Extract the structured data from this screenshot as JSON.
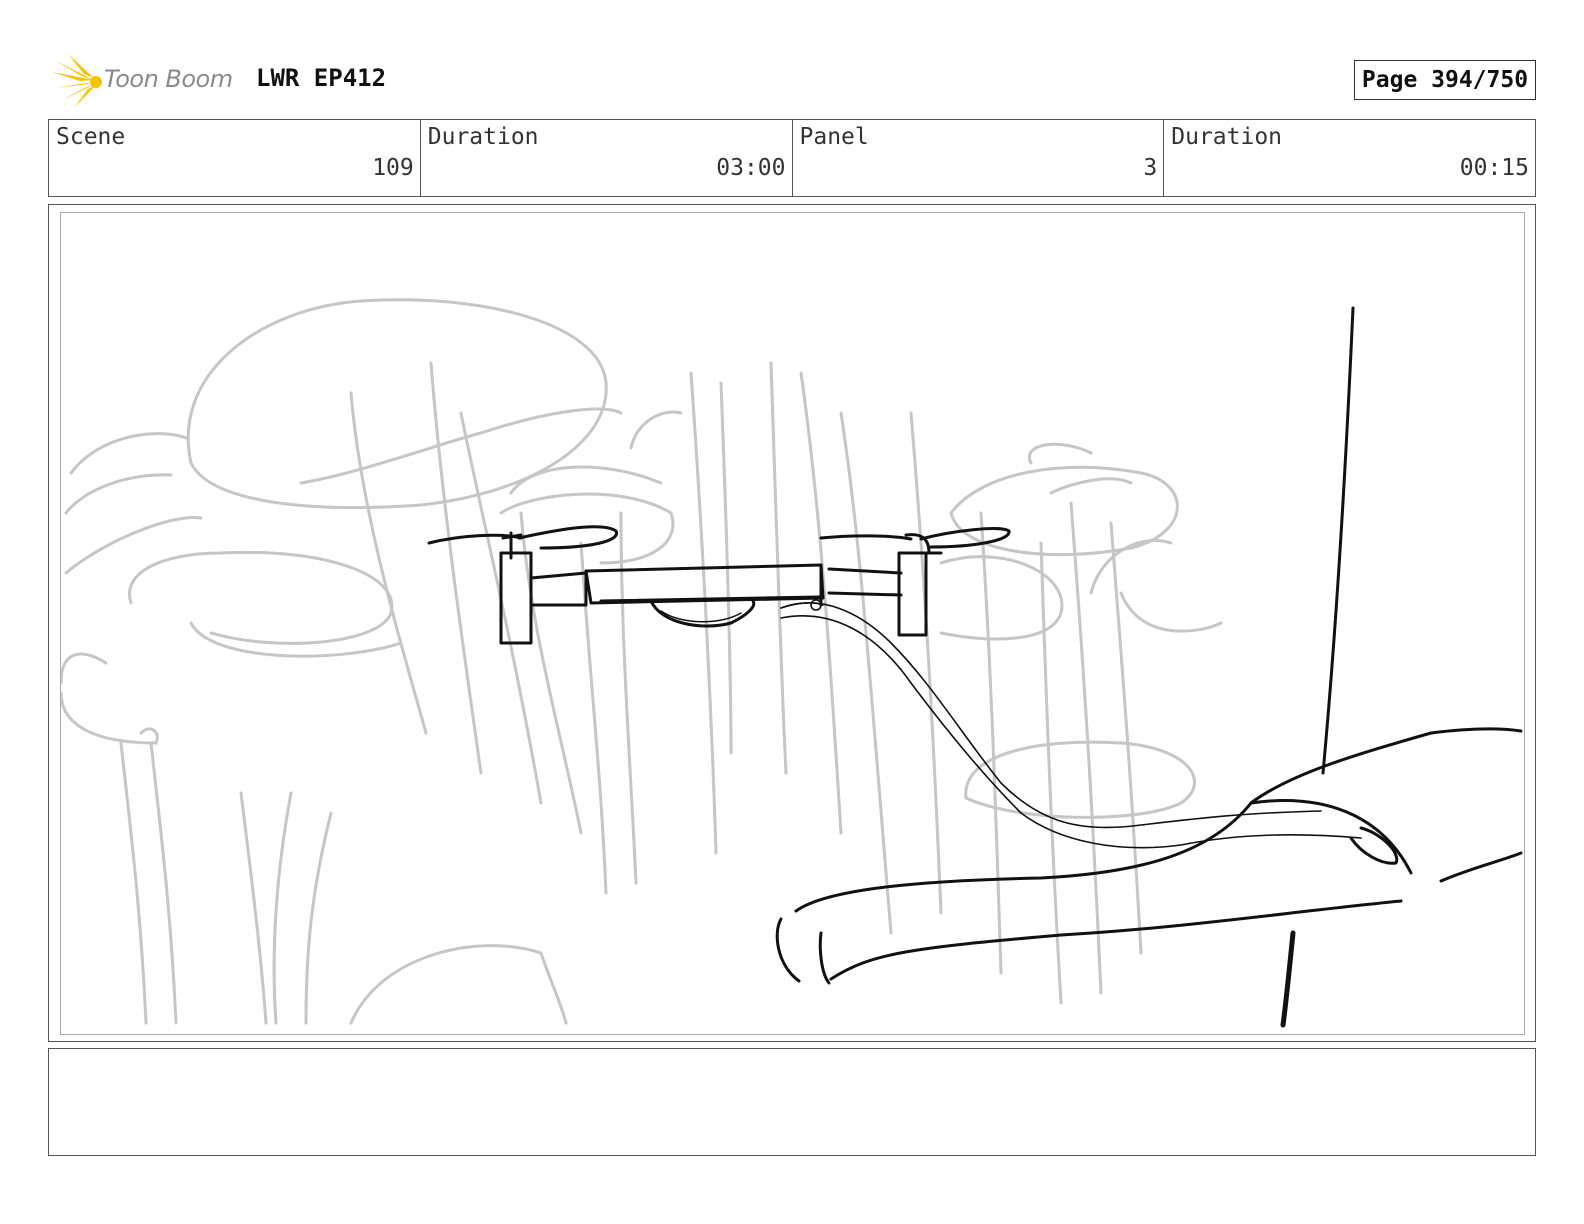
{
  "header": {
    "logo_text": "Toon Boom",
    "project_title": "LWR EP412",
    "page_indicator": "Page 394/750"
  },
  "info": {
    "scene_label": "Scene",
    "scene_value": "109",
    "scene_duration_label": "Duration",
    "scene_duration_value": "03:00",
    "panel_label": "Panel",
    "panel_value": "3",
    "panel_duration_label": "Duration",
    "panel_duration_value": "00:15"
  },
  "caption": {
    "text": ""
  },
  "colors": {
    "logo_yellow": "#f5c400",
    "sketch_gray": "#c4c4c4",
    "sketch_black": "#111111"
  }
}
